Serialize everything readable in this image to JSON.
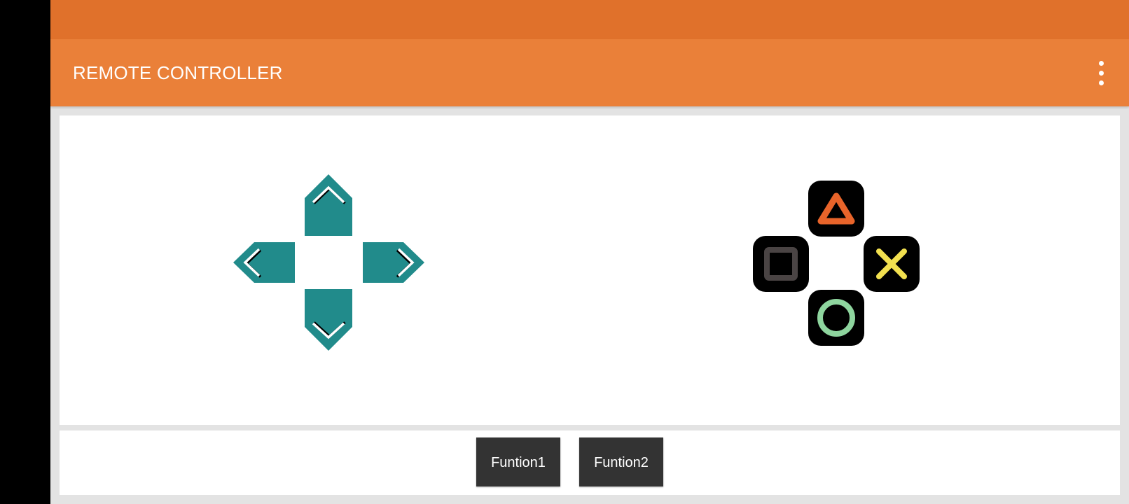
{
  "app": {
    "title": "REMOTE CONTROLLER"
  },
  "colors": {
    "status_bar": "#e0712b",
    "app_bar": "#ea8039",
    "dpad": "#218b8b",
    "action_button_bg": "#000000",
    "triangle": "#e8642a",
    "square": "#4a4444",
    "cross": "#f2e04f",
    "circle": "#8ed59e",
    "function_button_bg": "#333333"
  },
  "dpad": {
    "buttons": [
      "up-arrow-icon",
      "down-arrow-icon",
      "left-arrow-icon",
      "right-arrow-icon"
    ]
  },
  "action_buttons": {
    "icons": [
      "triangle-icon",
      "square-icon",
      "cross-icon",
      "circle-icon"
    ]
  },
  "functions": {
    "button1_label": "Funtion1",
    "button2_label": "Funtion2"
  }
}
